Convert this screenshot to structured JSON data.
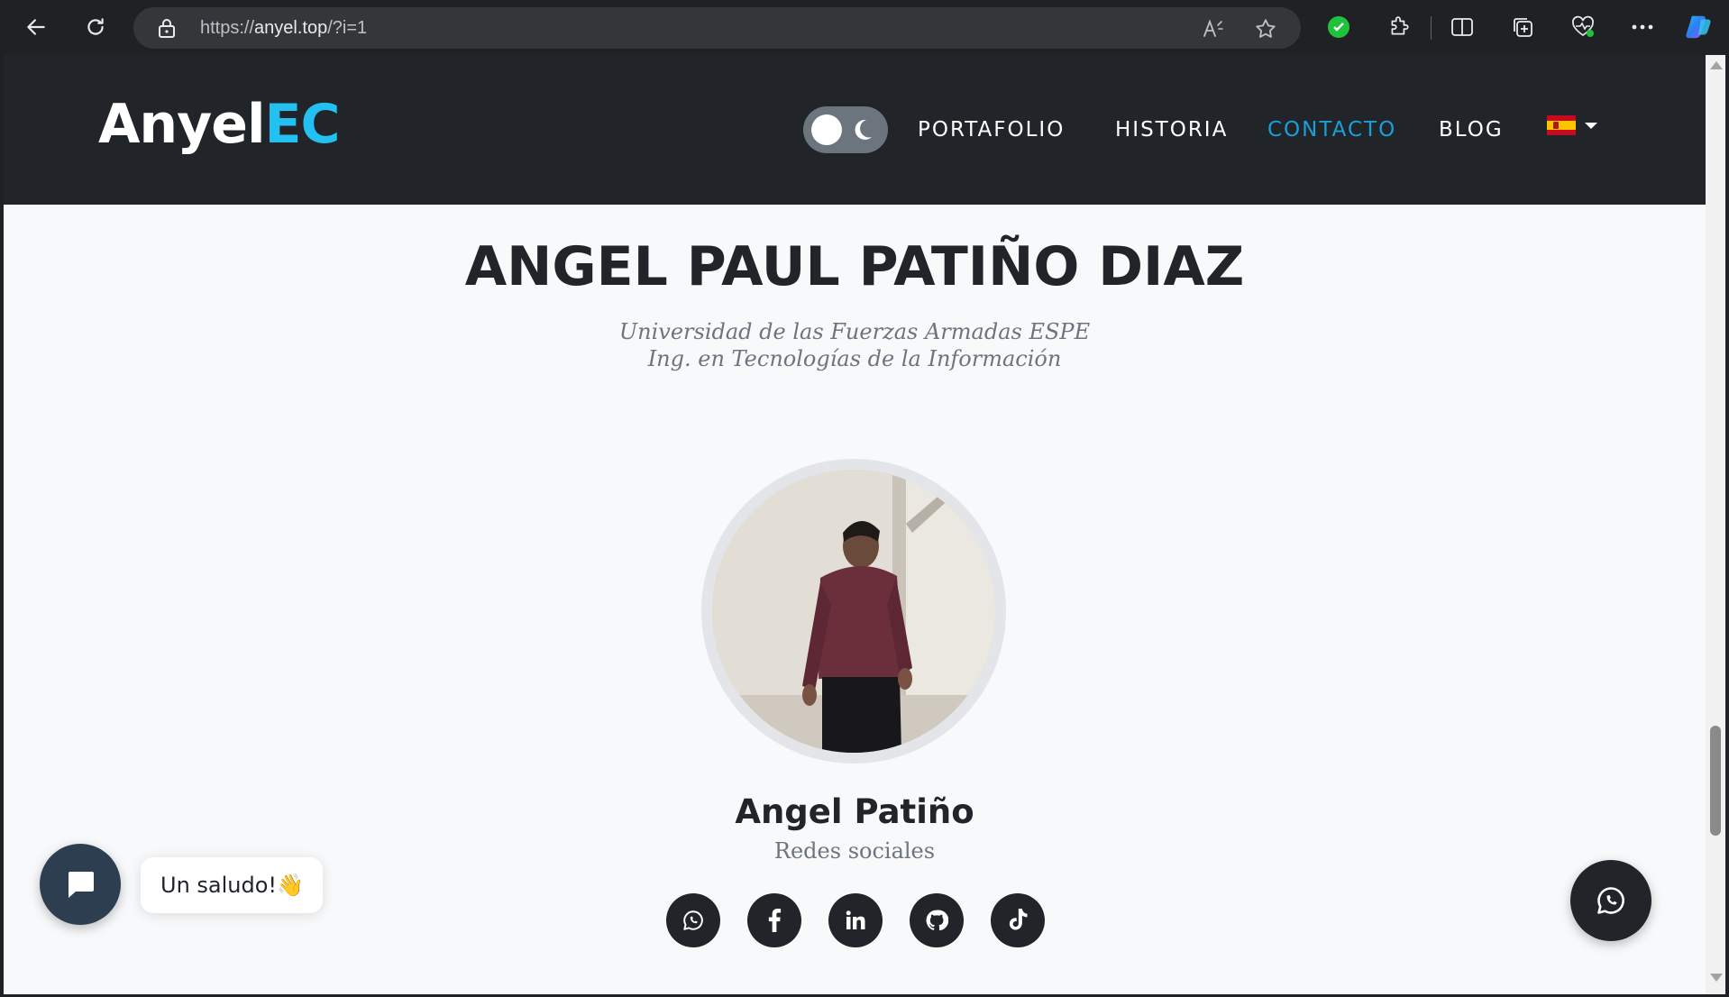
{
  "browser": {
    "url_scheme": "https://",
    "url_host": "anyel.top",
    "url_path": "/?i=1"
  },
  "site": {
    "logo_main": "Anyel",
    "logo_accent": "EC",
    "nav": {
      "portfolio": "PORTAFOLIO",
      "history": "HISTORIA",
      "contact": "CONTACTO",
      "blog": "BLOG"
    },
    "language": "es",
    "accent_color": "#22c1f1",
    "active_link_color": "#1a9fd8"
  },
  "profile": {
    "full_name": "ANGEL PAUL PATIÑO DIAZ",
    "university": "Universidad de las Fuerzas Armadas ESPE",
    "degree": "Ing. en Tecnologías de la Información",
    "display_name": "Angel Patiño",
    "social_label": "Redes sociales",
    "socials": [
      "whatsapp-icon",
      "facebook-icon",
      "linkedin-icon",
      "github-icon",
      "tiktok-icon"
    ]
  },
  "chat": {
    "greeting": "Un saludo!👋"
  }
}
